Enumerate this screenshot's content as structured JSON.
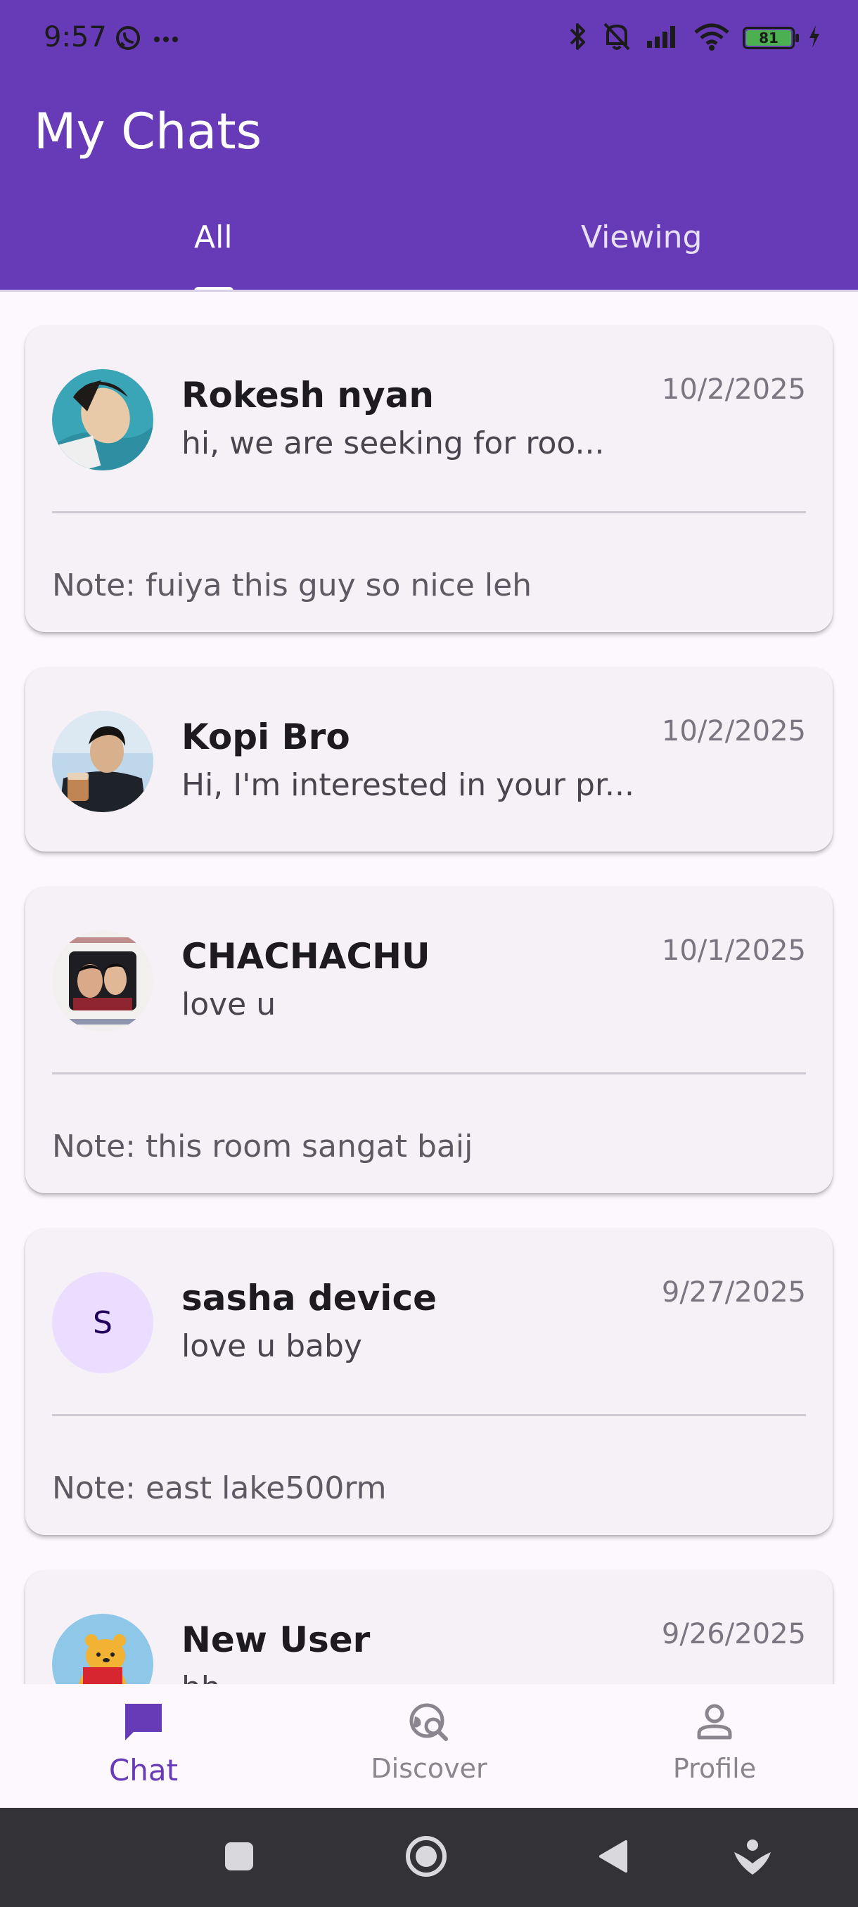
{
  "status_bar": {
    "time": "9:57",
    "battery_level": "81"
  },
  "header": {
    "title": "My Chats",
    "tabs": [
      {
        "label": "All",
        "selected": true
      },
      {
        "label": "Viewing",
        "selected": false
      }
    ]
  },
  "chats": [
    {
      "name": "Rokesh nyan",
      "message": "hi, we are seeking for roo...",
      "date": "10/2/2025",
      "note": "Note: fuiya this guy so nice leh"
    },
    {
      "name": "Kopi Bro",
      "message": "Hi, I'm interested in your pr...",
      "date": "10/2/2025"
    },
    {
      "name": "CHACHACHU",
      "message": "love u",
      "date": "10/1/2025",
      "note": "Note: this room sangat baij"
    },
    {
      "name": "sasha device",
      "avatar_letter": "S",
      "message": "love u baby",
      "date": "9/27/2025",
      "note": "Note: east lake500rm"
    },
    {
      "name": "New User",
      "message": "hh",
      "date": "9/26/2025"
    }
  ],
  "bottom_nav": [
    {
      "label": "Chat",
      "icon": "chat-bubble-icon",
      "selected": true
    },
    {
      "label": "Discover",
      "icon": "discover-icon",
      "selected": false
    },
    {
      "label": "Profile",
      "icon": "person-icon",
      "selected": false
    }
  ],
  "colors": {
    "primary": "#673AB7",
    "card_bg": "#F6F0F7",
    "page_bg": "#FDF8FD"
  }
}
